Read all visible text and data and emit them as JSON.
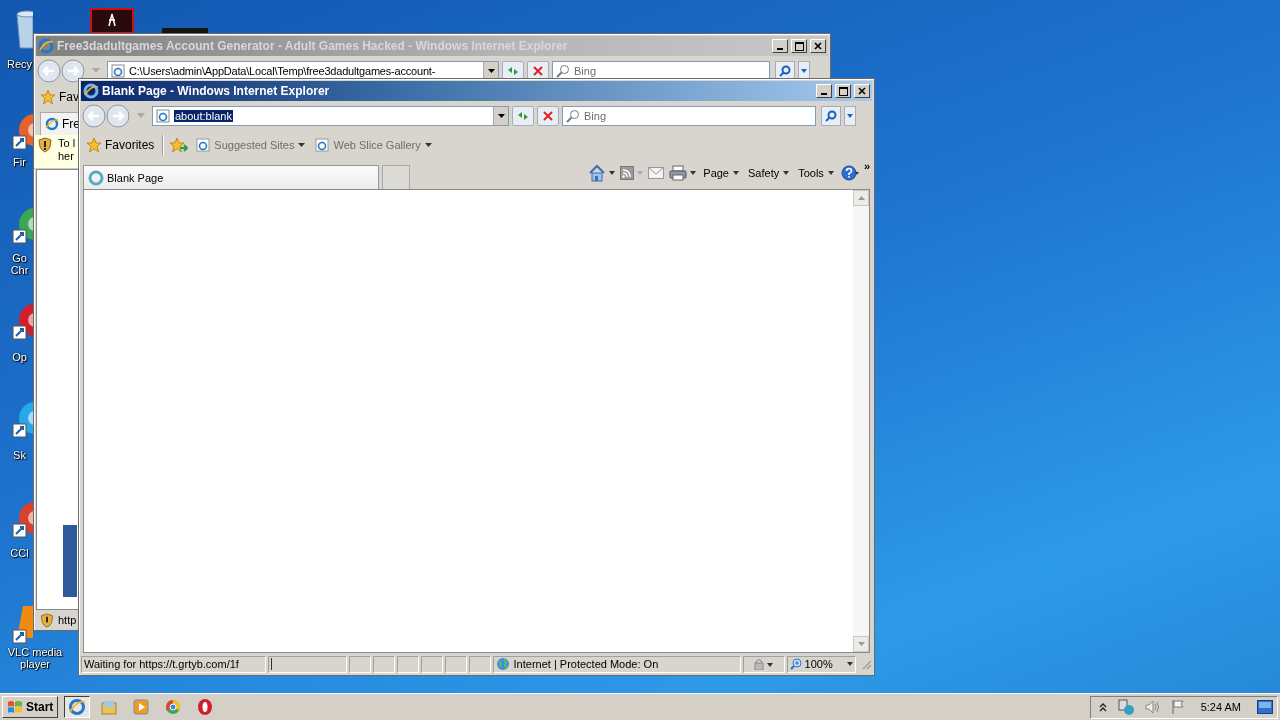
{
  "desktop_icons": [
    {
      "kind": "recycle",
      "label": "Recy"
    },
    {
      "kind": "firefox",
      "label": "Fir"
    },
    {
      "kind": "chrome",
      "label": "Go Chr"
    },
    {
      "kind": "opera",
      "label": "Op"
    },
    {
      "kind": "skype",
      "label": "Sk"
    },
    {
      "kind": "ccleaner",
      "label": "CCl"
    },
    {
      "kind": "vlc",
      "label": "VLC media player"
    }
  ],
  "back_window": {
    "title": "Free3dadultgames Account Generator - Adult Games Hacked - Windows Internet Explorer",
    "address": "C:\\Users\\admin\\AppData\\Local\\Temp\\free3dadultgames-account-",
    "search_placeholder": "Bing",
    "favorites_label": "Fav",
    "tab_label": "Fre",
    "info_bar": [
      "To l",
      "her"
    ],
    "status_text": "http"
  },
  "front_window": {
    "title": "Blank Page - Windows Internet Explorer",
    "address": {
      "value": "about:blank",
      "selected": true
    },
    "search_placeholder": "Bing",
    "favorites_label": "Favorites",
    "favorites_items": [
      "Suggested Sites",
      "Web Slice Gallery"
    ],
    "tab_label": "Blank Page",
    "command_menus": [
      "Page",
      "Safety",
      "Tools"
    ],
    "overflow_chevron": "»",
    "status_text": "Waiting for https://t.grtyb.com/1f",
    "zone_text": "Internet | Protected Mode: On",
    "zoom": "100%"
  },
  "taskbar": {
    "start_label": "Start",
    "apps": [
      {
        "kind": "ie",
        "selected": true
      },
      {
        "kind": "folder",
        "selected": false
      },
      {
        "kind": "media",
        "selected": false
      },
      {
        "kind": "chrome",
        "selected": false
      },
      {
        "kind": "opera",
        "selected": false
      }
    ],
    "clock": "5:24 AM"
  }
}
